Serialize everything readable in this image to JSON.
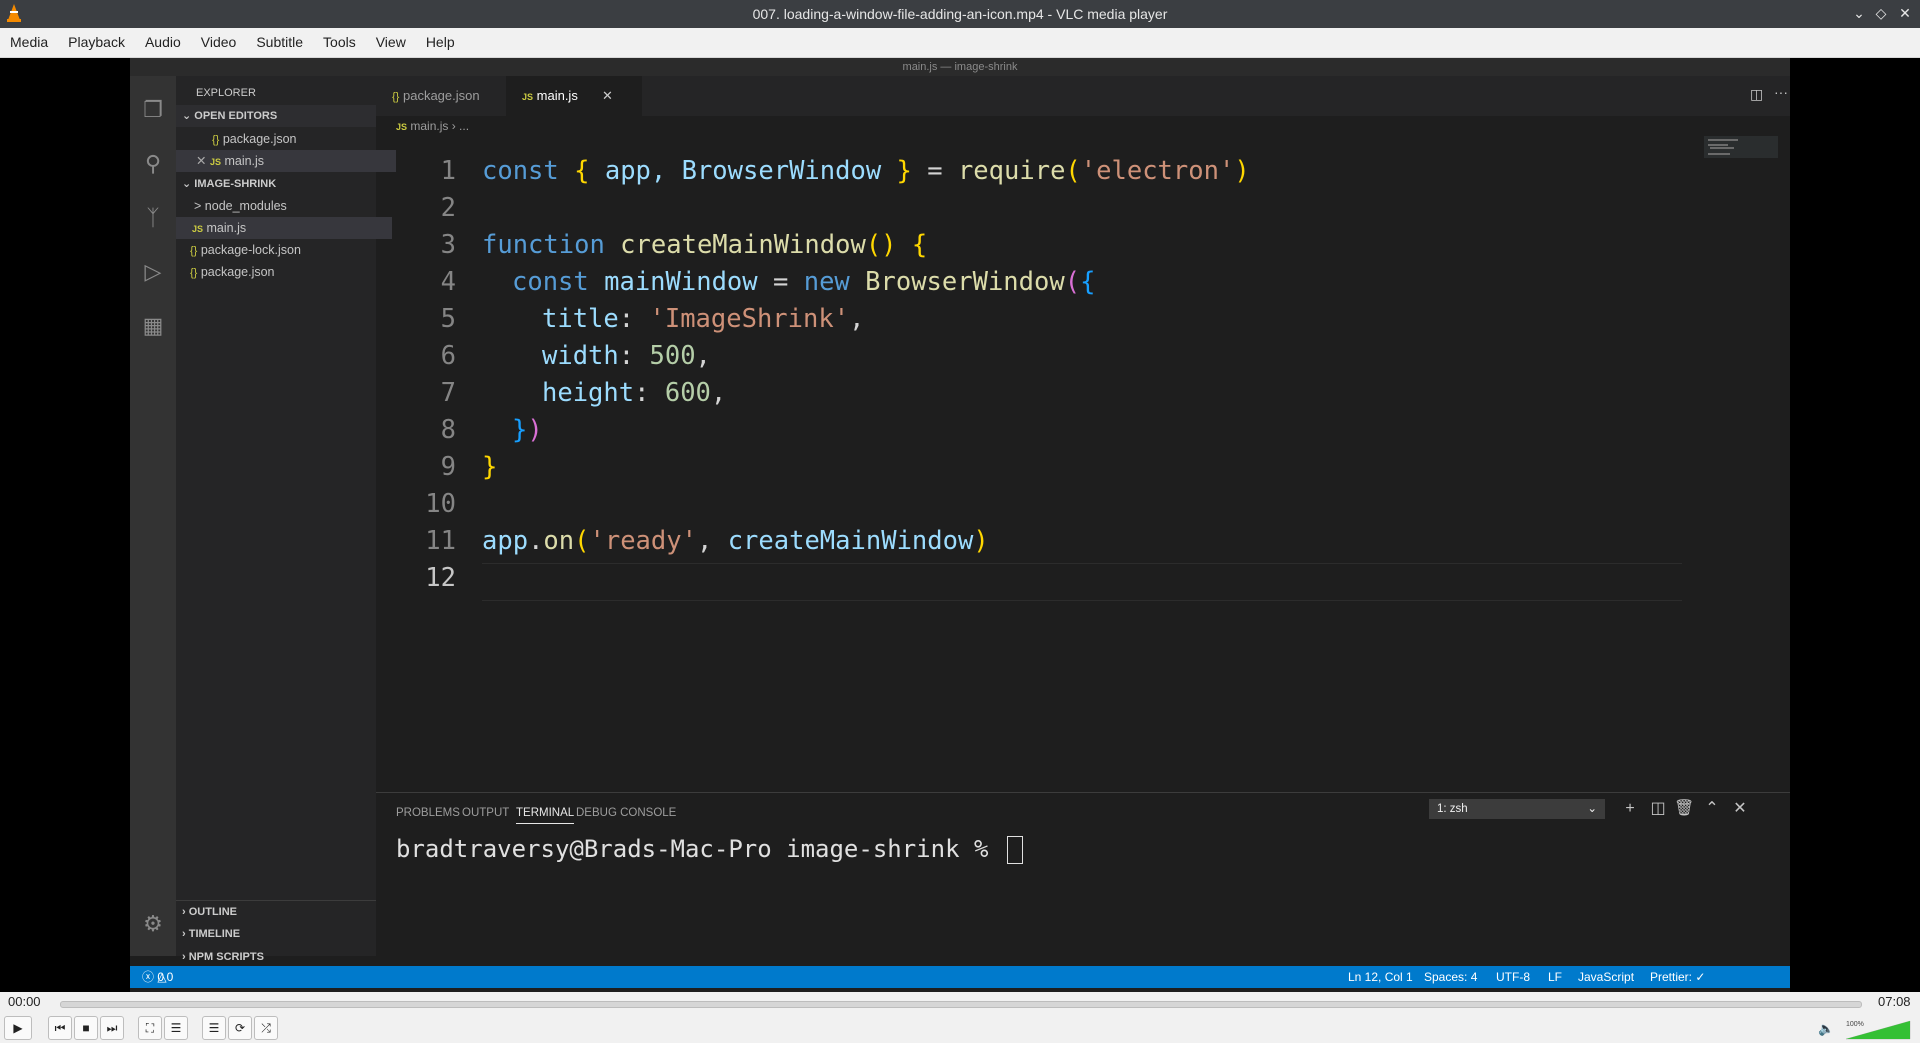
{
  "vlc": {
    "window_title": "007. loading-a-window-file-adding-an-icon.mp4 - VLC media player",
    "menu": [
      "Media",
      "Playback",
      "Audio",
      "Video",
      "Subtitle",
      "Tools",
      "View",
      "Help"
    ],
    "time_elapsed": "00:00",
    "time_total": "07:08",
    "volume_label": "100%",
    "volume_level": 1.0,
    "progress": 0.0
  },
  "editor": {
    "window_title": "main.js — image-shrink",
    "sidebar": {
      "title": "EXPLORER",
      "open_editors_header": "OPEN EDITORS",
      "open_editors": [
        {
          "icon": "{}",
          "name": "package.json"
        },
        {
          "icon": "JS",
          "name": "main.js"
        }
      ],
      "project_header": "IMAGE-SHRINK",
      "files": [
        {
          "icon": ">",
          "name": "node_modules"
        },
        {
          "icon": "JS",
          "name": "main.js"
        },
        {
          "icon": "{}",
          "name": "package-lock.json"
        },
        {
          "icon": "{}",
          "name": "package.json"
        }
      ],
      "bottom_sections": [
        "OUTLINE",
        "TIMELINE",
        "NPM SCRIPTS"
      ]
    },
    "tabs": [
      {
        "icon": "{}",
        "label": "package.json"
      },
      {
        "icon": "JS",
        "label": "main.js"
      }
    ],
    "breadcrumb": {
      "file": "main.js",
      "rest": "..."
    },
    "line_numbers": [
      "1",
      "2",
      "3",
      "4",
      "5",
      "6",
      "7",
      "8",
      "9",
      "10",
      "11",
      "12"
    ],
    "code": {
      "l1": {
        "kw": "const",
        "b1": "{",
        "vars": " app, BrowserWindow ",
        "b2": "}",
        "eq": " = ",
        "fn": "require",
        "p1": "(",
        "str": "'electron'",
        "p2": ")"
      },
      "l3": {
        "kw": "function",
        "fn": " createMainWindow",
        "parens": "()",
        "brace": "{"
      },
      "l4": {
        "kw": "const",
        "var": " mainWindow",
        "eq": " = ",
        "kw2": "new",
        "fn": " BrowserWindow",
        "p": "(",
        "b": "{"
      },
      "l5": {
        "key": "title",
        "colon": ": ",
        "str": "'ImageShrink'",
        "comma": ","
      },
      "l6": {
        "key": "width",
        "colon": ": ",
        "num": "500",
        "comma": ","
      },
      "l7": {
        "key": "height",
        "colon": ": ",
        "num": "600",
        "comma": ","
      },
      "l8": {
        "b": "}",
        "p": ")"
      },
      "l9": {
        "brace": "}"
      },
      "l11": {
        "obj": "app",
        "dot": ".",
        "fn": "on",
        "p1": "(",
        "str": "'ready'",
        "sep": ", ",
        "arg": "createMainWindow",
        "p2": ")"
      }
    },
    "panel": {
      "tabs": [
        "PROBLEMS",
        "OUTPUT",
        "TERMINAL",
        "DEBUG CONSOLE"
      ],
      "terminal_select": "1: zsh",
      "prompt": "bradtraversy@Brads-Mac-Pro image-shrink % "
    },
    "status": {
      "errors": "0",
      "warnings": "0",
      "position": "Ln 12, Col 1",
      "spaces": "Spaces: 4",
      "encoding": "UTF-8",
      "eol": "LF",
      "language": "JavaScript",
      "prettier": "Prettier: ✓"
    },
    "accent_color": "#007acc"
  }
}
